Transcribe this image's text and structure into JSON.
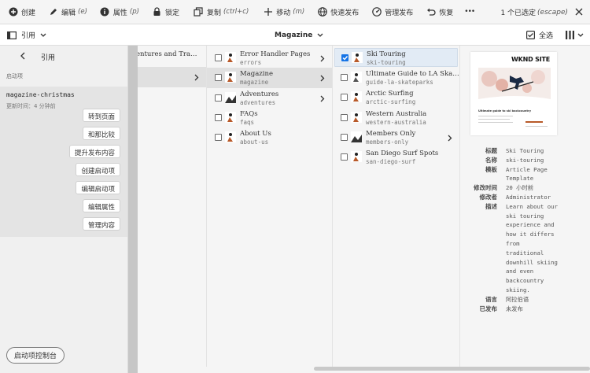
{
  "actionbar": {
    "create": "创建",
    "edit": "编辑",
    "edit_shortcut": "(e)",
    "properties": "属性",
    "properties_shortcut": "(p)",
    "lock": "锁定",
    "copy": "复制",
    "copy_shortcut": "(ctrl+c)",
    "move": "移动",
    "move_shortcut": "(m)",
    "quick_publish": "快速发布",
    "manage_publication": "管理发布",
    "restore": "恢复",
    "more": "•••",
    "selection_count": "1 个已选定",
    "selection_shortcut": "(escape)"
  },
  "viewbar": {
    "rail_label": "引用",
    "location": "Magazine",
    "select_all": "全选"
  },
  "rail": {
    "title": "引用",
    "section": "启动项",
    "launch_name": "magazine-christmas",
    "launch_updated": "更新时间：4 分钟前",
    "buttons": [
      "转到页面",
      "和那比较",
      "提升发布内容",
      "创建启动项",
      "编辑启动项",
      "编辑属性",
      "管理内容"
    ],
    "console_button": "启动项控制台"
  },
  "columns": {
    "col1": [
      {
        "title": "entures and Tra…"
      },
      {
        "title": ""
      }
    ],
    "col2": [
      {
        "title": "Error Handler Pages",
        "name": "errors",
        "has_children": true
      },
      {
        "title": "Magazine",
        "name": "magazine",
        "has_children": true,
        "selected": true
      },
      {
        "title": "Adventures",
        "name": "adventures",
        "has_children": true
      },
      {
        "title": "FAQs",
        "name": "faqs",
        "has_children": false
      },
      {
        "title": "About Us",
        "name": "about-us",
        "has_children": false
      }
    ],
    "col3": [
      {
        "title": "Ski Touring",
        "name": "ski-touring",
        "checked": true
      },
      {
        "title": "Ultimate Guide to LA Ska…",
        "name": "guide-la-skateparks"
      },
      {
        "title": "Arctic Surfing",
        "name": "arctic-surfing"
      },
      {
        "title": "Western Australia",
        "name": "western-australia"
      },
      {
        "title": "Members Only",
        "name": "members-only",
        "has_children": true
      },
      {
        "title": "San Diego Surf Spots",
        "name": "san-diego-surf"
      }
    ]
  },
  "preview": {
    "logo": "WKND SITE",
    "caption": "Ultimate guide to ski backcountry",
    "meta": [
      {
        "key": "标题",
        "value": "Ski Touring"
      },
      {
        "key": "名称",
        "value": "ski-touring"
      },
      {
        "key": "模板",
        "value": "Article Page Template"
      },
      {
        "key": "修改时间",
        "value": "20 小时前"
      },
      {
        "key": "修改者",
        "value": "Administrator"
      },
      {
        "key": "描述",
        "value": "Learn about our ski touring experience and how it differs from traditional downhill skiing and even backcountry skiing."
      },
      {
        "key": "语言",
        "value": "阿拉伯语"
      },
      {
        "key": "已发布",
        "value": "未发布"
      }
    ]
  },
  "colors": {
    "accent": "#1473e6",
    "selection": "#e0e0e0",
    "checked_row": "#e2ebf5"
  }
}
